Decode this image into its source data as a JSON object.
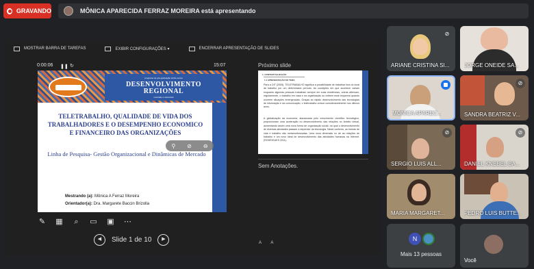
{
  "recording": {
    "label": "GRAVANDO"
  },
  "presenter": {
    "text": "MÔNICA APARECIDA FERRAZ MOREIRA está apresentando"
  },
  "presenter_view": {
    "toolbar": {
      "show_taskbar": "MOSTRAR BARRA DE TAREFAS",
      "display_settings": "EXIBIR CONFIGURAÇÕES ▾",
      "end_show": "ENCERRAR APRESENTAÇÃO DE SLIDES"
    },
    "timer": "0:00:06",
    "clock": "15:07",
    "current_slide": {
      "header_small": "programa de pós-graduação stricto sensu",
      "header_title_1": "DESENVOLVIMENTO",
      "header_title_2": "REGIONAL",
      "header_levels": "mestrado e doutorado",
      "title": "TELETRABALHO, QUALIDADE DE VIDA DOS TRABALHADORES E O DESEMPENHO ECONOMICO E FINANCEIRO DAS ORGANIZAÇÕES",
      "subtitle": "Linha de Pesquisa- Gestão Organizacional e Dinâmicas de Mercado",
      "mestrando_label": "Mestrando (a):",
      "mestrando_name": " Mônica A Ferraz Moreira",
      "orientador_label": "Orientador(a):",
      "orientador_name": " Dra. Margarete Baccin Brizolla"
    },
    "navigation": {
      "slide_label": "Slide 1 de 10"
    },
    "next_slide_label": "Próximo slide",
    "next_slide": {
      "heading1": "1. CONTEXTUALIZAÇÃO",
      "heading2": "1.1 APRESENTAÇÃO DO TEMA",
      "para1": "Para a OIT (2005), TELETRABALHO significa a possibilidade de trabalhar fora do local de trabalho por um determinado período. As condições em que acontece variam enquanto algumas pessoas trabalham sempre em suas residências, outras alternam, regularmente, o trabalho em casa e na organização ou exibem esse esquema quando ocorrem situações emergenciais. Graças ao rápido desenvolvimento das tecnologias de informação e da comunicação, o teletrabalho cresce consideravelmente nos últimos anos.",
      "para2": "A globalização da economia, alavancada pelo crescimento científico tecnológico, proporcionam uma aceleração no desenvolvimento das relações no âmbito virtual, aumentando assim uma nova forma de organização social, na qual o desenvolvimento de diversas atividades passam a depender da tecnologia. Neste contexto, as formas de vida e trabalho são metamorfoseadas. Uma nova dimensão no de as relações de trabalho e um novo ideal de desenvolvimento das atividades humanas na Internet. (RODRIGUES 2011)."
    },
    "notes_label": "Sem Anotações.",
    "font_buttons": [
      "A",
      "A"
    ]
  },
  "participants": [
    {
      "name": "ARIANE CRISTINA SI...",
      "muted": true,
      "speaking": false
    },
    {
      "name": "JORGE ONEIDE SA...",
      "muted": false,
      "speaking": false
    },
    {
      "name": "MÔNICA APAREC...",
      "muted": false,
      "speaking": true
    },
    {
      "name": "SANDRA BEATRIZ V...",
      "muted": true,
      "speaking": false
    },
    {
      "name": "SERGIO LUIS ALL...",
      "muted": true,
      "speaking": false
    },
    {
      "name": "DANIEL KNEBEL BA...",
      "muted": true,
      "speaking": false
    },
    {
      "name": "MARIA MARGARET...",
      "muted": false,
      "speaking": false
    },
    {
      "name": "PEDRO LUIS BUTTE...",
      "muted": false,
      "speaking": false
    }
  ],
  "more": {
    "initial": "N",
    "label": "Mais 13 pessoas"
  },
  "you": {
    "label": "Você"
  },
  "colors": {
    "record_red": "#d93025",
    "speaking_blue": "#1a73e8",
    "slide_blue": "#2e57a4"
  }
}
